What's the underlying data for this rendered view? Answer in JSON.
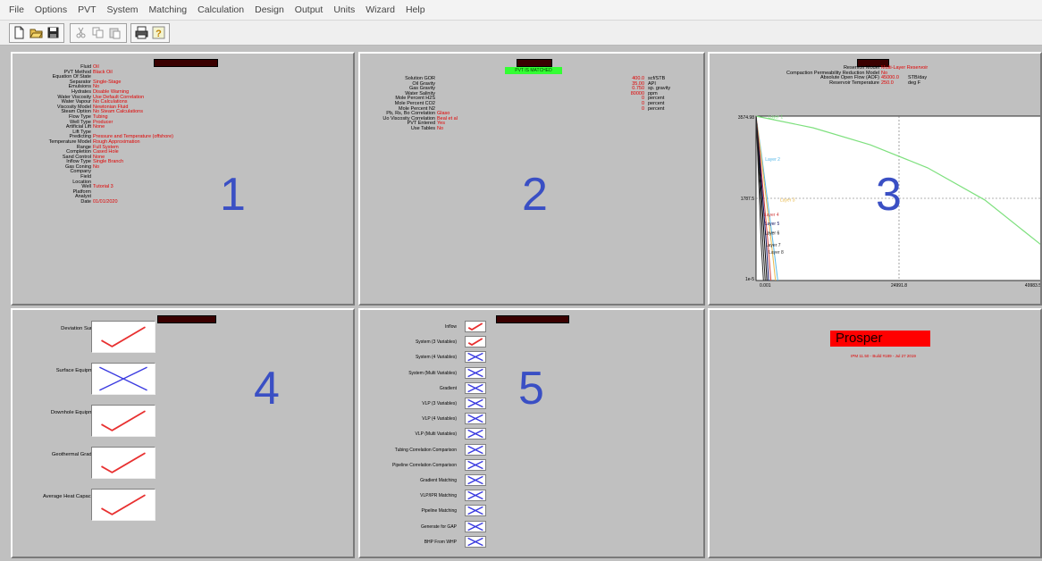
{
  "menu": [
    "File",
    "Options",
    "PVT",
    "System",
    "Matching",
    "Calculation",
    "Design",
    "Output",
    "Units",
    "Wizard",
    "Help"
  ],
  "toolbar": {
    "icons": [
      "new-file-icon",
      "open-folder-icon",
      "save-icon",
      "cut-icon",
      "copy-icon",
      "paste-icon",
      "print-icon",
      "help-icon"
    ]
  },
  "panels": {
    "p1": {
      "number": "1",
      "labels": [
        "Fluid",
        "PVT Method",
        "Equation Of State",
        "Separator",
        "Emulsions",
        "Hydrates",
        "Water Viscosity",
        "Water Vapour",
        "Viscosity Model",
        "Steam Option",
        "Flow Type",
        "Well Type",
        "Artificial Lift",
        "Lift Type",
        "Predicting",
        "Temperature Model",
        "Range",
        "Completion",
        "Sand Control",
        "Inflow Type",
        "Gas Coning",
        "Company",
        "Field",
        "Location",
        "Well",
        "Platform",
        "Analyst",
        "Date"
      ],
      "values": [
        "Oil",
        "Black Oil",
        "",
        "Single-Stage",
        "No",
        "Disable Warning",
        "Use Default Correlation",
        "No Calculations",
        "Newtonian Fluid",
        "No Steam Calculations",
        "Tubing",
        "Producer",
        "None",
        "",
        "Pressure and Temperature (offshore)",
        "Rough Approximation",
        "Full System",
        "Cased Hole",
        "None",
        "Single Branch",
        "No",
        "",
        "",
        "",
        "Tutorial 3",
        "",
        "",
        "01/01/2020"
      ]
    },
    "p2": {
      "number": "2",
      "status": "PVT IS MATCHED",
      "labels": [
        "Solution GOR",
        "Oil Gravity",
        "Gas Gravity",
        "Water Salinity",
        "Mole Percent H2S",
        "Mole Percent CO2",
        "Mole Percent N2",
        "Pb, Rs, Bo Correlation",
        "Uo Viscosity Correlation",
        "PVT Entered",
        "Use Tables"
      ],
      "values": [
        "400.0",
        "35.00",
        "0.750",
        "80000",
        "0",
        "0",
        "0",
        "Glaso",
        "Beal et al",
        "Yes",
        "No"
      ],
      "units": [
        "scf/STB",
        "API",
        "sp. gravity",
        "ppm",
        "percent",
        "percent",
        "percent",
        "",
        "",
        "",
        ""
      ]
    },
    "p3": {
      "number": "3",
      "info_labels": [
        "Reservoir Model",
        "Compaction Permeability Reduction Model",
        "Absolute Open Flow (AOF)",
        "Reservoir Temperature"
      ],
      "info_values": [
        "Multi-Layer Reservoir",
        "No",
        "45000.0",
        "250.0"
      ],
      "info_units": [
        "",
        "",
        "STB/day",
        "deg F"
      ],
      "series_labels": [
        "Layer 1",
        "Layer 2",
        "Layer 3",
        "Layer 4",
        "Layer 5",
        "Layer 6",
        "Layer 7",
        "Layer 8"
      ],
      "tick_y": [
        "3574.98",
        "1787.5",
        "1e-5"
      ],
      "tick_x": [
        "0.001",
        "24991.8",
        "49983.5"
      ]
    },
    "p4": {
      "number": "4",
      "rows": [
        {
          "label": "Deviation Survey",
          "state": "check"
        },
        {
          "label": "Surface Equipment",
          "state": "cross"
        },
        {
          "label": "Downhole Equipment",
          "state": "check"
        },
        {
          "label": "Geothermal Gradient",
          "state": "check"
        },
        {
          "label": "Average Heat Capacities",
          "state": "check"
        }
      ]
    },
    "p5": {
      "number": "5",
      "rows": [
        {
          "label": "Inflow",
          "state": "check"
        },
        {
          "label": "System (3 Variables)",
          "state": "check"
        },
        {
          "label": "System (4 Variables)",
          "state": "cross"
        },
        {
          "label": "System (Multi Variables)",
          "state": "cross"
        },
        {
          "label": "Gradient",
          "state": "cross"
        },
        {
          "label": "VLP (3 Variables)",
          "state": "cross"
        },
        {
          "label": "VLP (4 Variables)",
          "state": "cross"
        },
        {
          "label": "VLP (Multi Variables)",
          "state": "cross"
        },
        {
          "label": "Tubing Correlation Comparison",
          "state": "cross"
        },
        {
          "label": "Pipeline Correlation Comparison",
          "state": "cross"
        },
        {
          "label": "Gradient Matching",
          "state": "cross"
        },
        {
          "label": "VLP/IPR Matching",
          "state": "cross"
        },
        {
          "label": "Pipeline Matching",
          "state": "cross"
        },
        {
          "label": "Generate for GAP",
          "state": "cross"
        },
        {
          "label": "BHP From WHP",
          "state": "cross"
        }
      ]
    },
    "p6": {
      "banner": "Prosper",
      "version": "IPM 11.50 - Build #189 - Jul 27 2019"
    }
  },
  "colors": {
    "panel_bg": "#c0c0c0",
    "title_bar": "#3a0000",
    "value_red": "#e00000",
    "panel_number": "#3a4fc4",
    "matched_green": "#33ff33",
    "check_red": "#e83030",
    "cross_blue": "#3a3ae0",
    "banner_red": "#ff0000"
  },
  "chart_data": {
    "type": "line",
    "title": "",
    "xlabel": "",
    "ylabel": "",
    "xlim": [
      0.001,
      49983.5
    ],
    "ylim": [
      1e-05,
      3574.98
    ],
    "x_ticks": [
      "0.001",
      "24991.8",
      "49983.5"
    ],
    "y_ticks": [
      "3574.98",
      "1787.5",
      "1e-5"
    ],
    "grid": true,
    "series": [
      {
        "name": "Layer 1",
        "color": "#7ee07e",
        "x": [
          0,
          10000,
          20000,
          30000,
          40000,
          49983.5
        ],
        "y": [
          3575,
          3320,
          2950,
          2450,
          1750,
          760
        ]
      },
      {
        "name": "Layer 2",
        "color": "#55b8e8",
        "x": [
          0,
          1000,
          2000,
          3000,
          3800
        ],
        "y": [
          3575,
          2700,
          1750,
          800,
          0
        ]
      },
      {
        "name": "Layer 3",
        "color": "#e8b84a",
        "x": [
          0,
          900,
          1800,
          2700,
          3400
        ],
        "y": [
          3575,
          2700,
          1750,
          800,
          0
        ]
      },
      {
        "name": "Layer 4",
        "color": "#d04040",
        "x": [
          0,
          700,
          1400,
          2100,
          2600
        ],
        "y": [
          3575,
          2700,
          1750,
          800,
          0
        ]
      },
      {
        "name": "Layer 5",
        "color": "#101060",
        "x": [
          0,
          600,
          1200,
          1800,
          2200
        ],
        "y": [
          3575,
          2700,
          1750,
          800,
          0
        ]
      },
      {
        "name": "Layer 6",
        "color": "#000000",
        "x": [
          0,
          500,
          1000,
          1500,
          1900
        ],
        "y": [
          3575,
          2700,
          1750,
          800,
          0
        ]
      },
      {
        "name": "Layer 7",
        "color": "#202020",
        "x": [
          0,
          400,
          800,
          1200,
          1600
        ],
        "y": [
          3575,
          2700,
          1750,
          800,
          0
        ]
      },
      {
        "name": "Layer 8",
        "color": "#303030",
        "x": [
          0,
          300,
          600,
          900,
          1300
        ],
        "y": [
          3575,
          2700,
          1750,
          800,
          0
        ]
      }
    ]
  }
}
